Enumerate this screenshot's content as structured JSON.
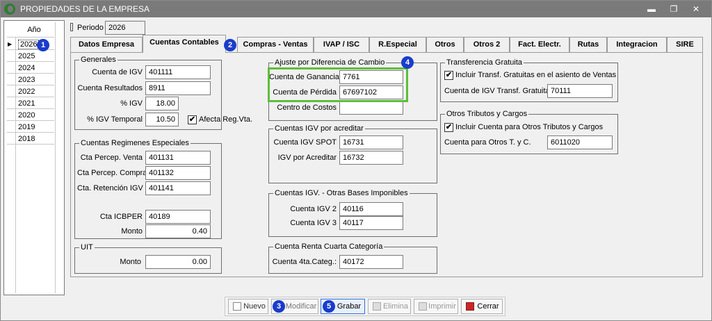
{
  "window": {
    "title": "PROPIEDADES DE LA EMPRESA",
    "controls": [
      "▬",
      "❐",
      "✕"
    ]
  },
  "years": {
    "header": "Año",
    "items": [
      "2026",
      "2025",
      "2024",
      "2023",
      "2022",
      "2021",
      "2020",
      "2019",
      "2018"
    ]
  },
  "periodo": {
    "label": "Periodo",
    "value": "2026"
  },
  "tabs": [
    "Datos Empresa",
    "Cuentas Contables",
    "Compras - Ventas",
    "IVAP / ISC",
    "R.Especial",
    "Otros",
    "Otros 2",
    "Fact. Electr.",
    "Rutas",
    "Integracion",
    "SIRE"
  ],
  "badges": [
    "1",
    "2",
    "3",
    "4",
    "5"
  ],
  "generales": {
    "title": "Generales",
    "cuenta_igv_label": "Cuenta de IGV",
    "cuenta_igv": "401111",
    "cuenta_resultados_label": "Cuenta Resultados",
    "cuenta_resultados": "8911",
    "pct_igv_label": "% IGV",
    "pct_igv": "18.00",
    "pct_igv_temporal_label": "% IGV Temporal",
    "pct_igv_temporal": "10.50",
    "afecta_label": "Afecta Reg.Vta.",
    "afecta_check": "✔"
  },
  "regimenes": {
    "title": "Cuentas Regimenes Especiales",
    "percep_venta_label": "Cta Percep. Venta",
    "percep_venta": "401131",
    "percep_compra_label": "Cta Percep. Compra",
    "percep_compra": "401132",
    "retencion_label": "Cta. Retención IGV",
    "retencion": "401141",
    "icbper_label": "Cta ICBPER",
    "icbper": "40189",
    "monto_label": "Monto",
    "monto": "0.40"
  },
  "uit": {
    "title": "UIT",
    "monto_label": "Monto",
    "monto": "0.00"
  },
  "ajuste": {
    "title": "Ajuste por Diferencia de Cambio",
    "ganancia_label": "Cuenta de Ganancia",
    "ganancia": "7761",
    "perdida_label": "Cuenta de Pérdida",
    "perdida": "67697102",
    "centro_label": "Centro de Costos",
    "centro": ""
  },
  "igv_acreditar": {
    "title": "Cuentas IGV por acreditar",
    "spot_label": "Cuenta IGV SPOT",
    "spot": "16731",
    "acreditar_label": "IGV por Acreditar",
    "acreditar": "16732"
  },
  "otras_bases": {
    "title": "Cuentas IGV. - Otras Bases Imponibles",
    "igv2_label": "Cuenta IGV 2",
    "igv2": "40116",
    "igv3_label": "Cuenta IGV 3",
    "igv3": "40117"
  },
  "renta": {
    "title": "Cuenta Renta Cuarta Categoría",
    "label": "Cuenta 4ta.Categ.:",
    "value": "40172"
  },
  "transferencia": {
    "title": "Transferencia Gratuita",
    "incluir_label": "Incluir Transf. Gratuitas en el asiento de Ventas",
    "incluir_check": "✔",
    "cuenta_label": "Cuenta de IGV Transf. Gratuita",
    "cuenta": "70111"
  },
  "otros_tributos": {
    "title": "Otros Tributos y Cargos",
    "incluir_label": "Incluir Cuenta para Otros Tributos y Cargos",
    "incluir_check": "✔",
    "cuenta_label": "Cuenta para Otros T. y C.",
    "cuenta": "6011020"
  },
  "buttons": {
    "nuevo": "Nuevo",
    "modificar": "Modificar",
    "grabar": "Grabar",
    "elimina": "Elimina",
    "imprimir": "Imprimir",
    "cerrar": "Cerrar"
  },
  "colors": {
    "highlight": "#5cbf3a",
    "badge": "#1a3ccc",
    "titlebar": "#7a7a7a"
  }
}
